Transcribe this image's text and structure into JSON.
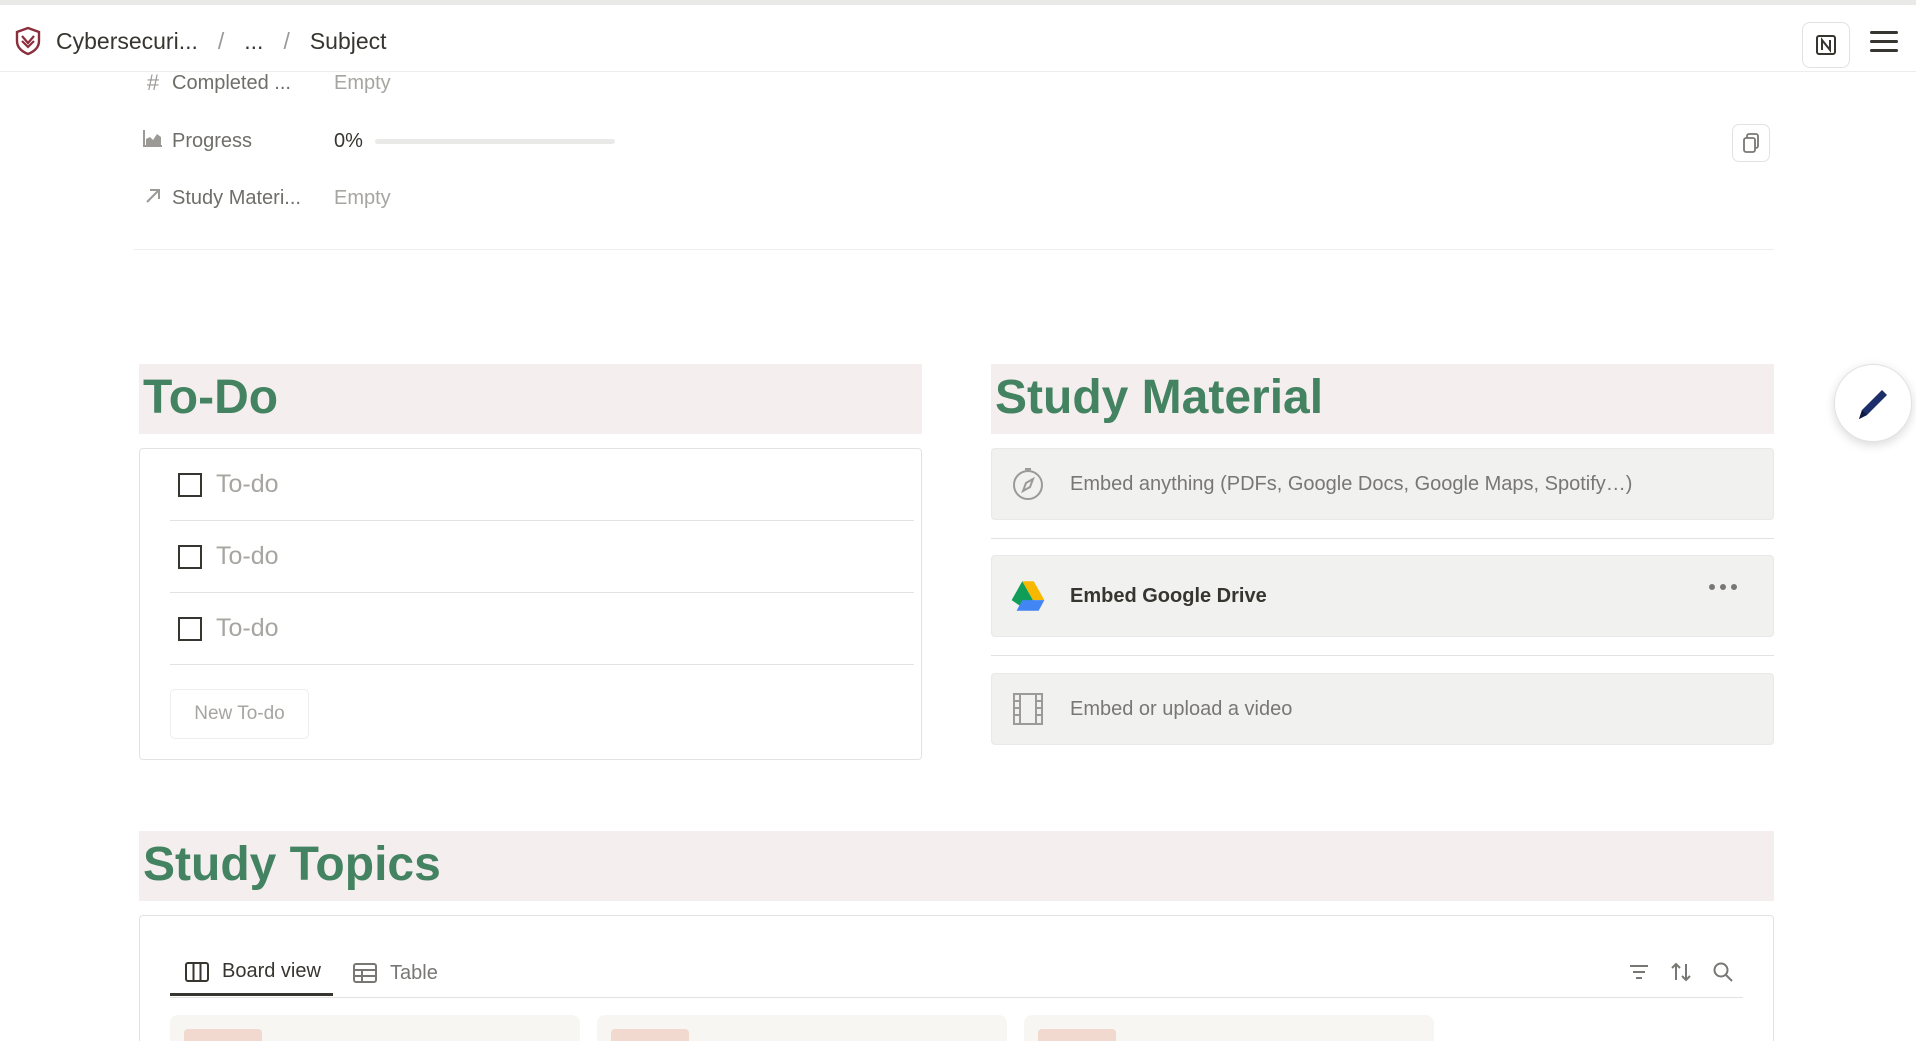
{
  "breadcrumb": {
    "workspace": "Cybersecuri...",
    "ellipsis": "...",
    "page": "Subject",
    "separator": "/"
  },
  "properties": [
    {
      "name": "Completed ...",
      "value": "Empty",
      "icon": "hash-icon"
    },
    {
      "name": "Progress",
      "value": "0%",
      "progress": 0,
      "icon": "chart-icon"
    },
    {
      "name": "Study Materi...",
      "value": "Empty",
      "icon": "relation-arrow-icon"
    }
  ],
  "todo": {
    "heading": "To-Do",
    "items": [
      "To-do",
      "To-do",
      "To-do"
    ],
    "new_button": "New To-do"
  },
  "study_material": {
    "heading": "Study Material",
    "embed_anything": "Embed anything (PDFs, Google Docs, Google Maps, Spotify…)",
    "google_drive": "Embed Google Drive",
    "video": "Embed or upload a video"
  },
  "topics": {
    "heading": "Study Topics",
    "tabs": [
      "Board view",
      "Table"
    ]
  },
  "colors": {
    "heading_text": "#448361",
    "heading_bg": "#f4eeee",
    "text": "#37352f",
    "muted": "#a6a5a1"
  }
}
